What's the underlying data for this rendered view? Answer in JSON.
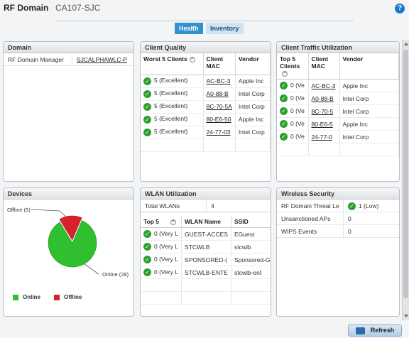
{
  "header": {
    "title": "RF Domain",
    "subtitle": "CA107-SJC",
    "help": "?"
  },
  "tabs": [
    {
      "label": "Health"
    },
    {
      "label": "Inventory"
    }
  ],
  "domain": {
    "title": "Domain",
    "rows": [
      {
        "key": "RF Domain Manager",
        "value": "SJCALPHAWLC-P"
      }
    ]
  },
  "client_quality": {
    "title": "Client Quality",
    "headers": {
      "c1": "Worst 5 Clients",
      "c2": "Client MAC",
      "c3": "Vendor"
    },
    "rows": [
      {
        "q": "5 (Excellent)",
        "mac": "AC-BC-3",
        "vendor": "Apple Inc"
      },
      {
        "q": "5 (Excellent)",
        "mac": "A0-88-B",
        "vendor": "Intel Corp"
      },
      {
        "q": "5 (Excellent)",
        "mac": "8C-70-5A",
        "vendor": "Intel Corp"
      },
      {
        "q": "5 (Excellent)",
        "mac": "80-E6-50",
        "vendor": "Apple Inc"
      },
      {
        "q": "5 (Excellent)",
        "mac": "24-77-03",
        "vendor": "Intel Corp"
      }
    ]
  },
  "traffic": {
    "title": "Client Traffic Utilization",
    "headers": {
      "c1": "Top 5 Clients",
      "c2": "Client MAC",
      "c3": "Vendor"
    },
    "rows": [
      {
        "q": "0 (Ve",
        "mac": "AC-BC-3",
        "vendor": "Apple Inc"
      },
      {
        "q": "0 (Ve",
        "mac": "A0-88-B",
        "vendor": "Intel Corp"
      },
      {
        "q": "0 (Ve",
        "mac": "8C-70-5",
        "vendor": "Intel Corp"
      },
      {
        "q": "0 (Ve",
        "mac": "80-E6-5",
        "vendor": "Apple Inc"
      },
      {
        "q": "0 (Ve",
        "mac": "24-77-0",
        "vendor": "Intel Corp"
      }
    ]
  },
  "devices": {
    "title": "Devices",
    "offline_label": "Offline (5)",
    "online_label": "Online (28)",
    "legend_online": "Online",
    "legend_offline": "Offline",
    "online": 28,
    "offline": 5,
    "colors": {
      "online": "#2fbf2f",
      "offline": "#d9212c"
    }
  },
  "wlan": {
    "title": "WLAN Utilization",
    "total_label": "Total WLANs",
    "total_value": "4",
    "headers": {
      "c1": "Top 5",
      "c2": "WLAN Name",
      "c3": "SSID"
    },
    "rows": [
      {
        "u": "0 (Very L",
        "name": "GUEST-ACCES",
        "ssid": "EGuest"
      },
      {
        "u": "0 (Very L",
        "name": "STCWLB",
        "ssid": "stcwlb"
      },
      {
        "u": "0 (Very L",
        "name": "SPONSORED-(",
        "ssid": "Sponsored-G"
      },
      {
        "u": "0 (Very L",
        "name": "STCWLB-ENTE",
        "ssid": "stcwlb-ent"
      }
    ]
  },
  "security": {
    "title": "Wireless Security",
    "rows": [
      {
        "key": "RF Domain Threat Le",
        "value": "1 (Low)"
      },
      {
        "key": "Unsanctioned APs",
        "value": "0"
      },
      {
        "key": "WIPS Events",
        "value": "0"
      }
    ]
  },
  "footer": {
    "refresh_label": "Refresh"
  }
}
